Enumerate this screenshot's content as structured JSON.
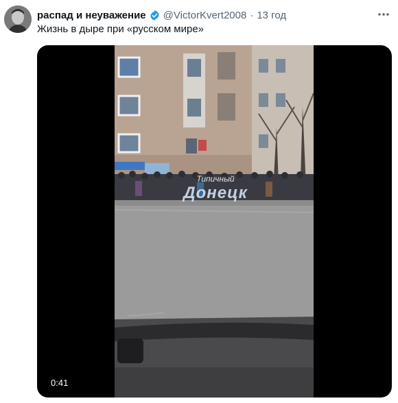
{
  "tweet": {
    "display_name": "распад и неуважение",
    "handle": "@VictorKvert2008",
    "separator": "·",
    "time": "13 год",
    "text": "Жизнь в дыре при «русском мире»"
  },
  "video": {
    "duration": "0:41",
    "watermark_line1": "Типичный",
    "watermark_line2": "Донецк"
  },
  "icons": {
    "verified": "verified-badge-icon",
    "more": "more-options-icon"
  },
  "colors": {
    "verified_blue": "#1d9bf0",
    "secondary_text": "#536471",
    "primary_text": "#0f1419"
  }
}
